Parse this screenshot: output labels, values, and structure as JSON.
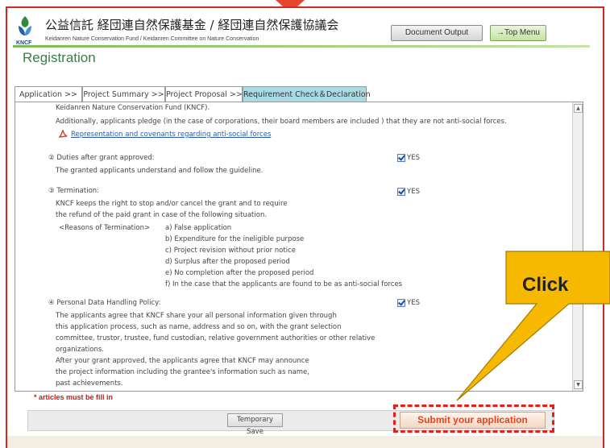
{
  "header": {
    "title_ja": "公益信託 経団連自然保護基金 / 経団連自然保護協議会",
    "title_en": "Keidanren Nature Conservation Fund / Keidanren Committee on Nature Conservation",
    "logo_text": "KNCF",
    "document_output_label": "Document Output",
    "top_menu_label": "→Top Menu"
  },
  "page": {
    "title": "Registration"
  },
  "tabs": [
    {
      "label": "Application >>"
    },
    {
      "label": "Project Summary >>"
    },
    {
      "label": "Project Proposal >>"
    },
    {
      "label": "Requirement Check＆Declaration",
      "active": true
    }
  ],
  "sections": {
    "s1": {
      "line1": "Keidanren Nature Conservation Fund (KNCF).",
      "line2": "Additionally, applicants pledge (in the case of corporations, their board members are included ) that they are not anti-social forces.",
      "link": "Representation and covenants regarding anti-social forces"
    },
    "s2": {
      "heading": "② Duties after grant approved:",
      "line1": "The granted applicants understand and follow the guideline.",
      "check": "YES"
    },
    "s3": {
      "heading": "③ Termination:",
      "line1": "KNCF keeps the right to stop and/or cancel the grant and to require",
      "line2": "the refund of the paid grant in case of the following situation.",
      "reasons_label": "<Reasons of Termination>",
      "reasons": [
        "a) False application",
        "b) Expenditure for the ineligible purpose",
        "c) Project revision without prior notice",
        "d) Surplus after the proposed period",
        "e) No completion after the proposed period",
        "f) In the case that the applicants are found to be as anti-social forces"
      ],
      "check": "YES"
    },
    "s4": {
      "heading": "④ Personal Data Handling Policy:",
      "lines": [
        "The applicants agree that KNCF share your all personal information given through",
        "this application process, such as name, address and so on, with the grant selection",
        "committee, trustor, trustee, fund custodian, relative government authorities or other relative",
        "organizations.",
        "After your grant approved,  the applicants agree that KNCF may announce",
        "the project information including the grantee's information such as name,",
        "past achievements."
      ],
      "check": "YES"
    }
  },
  "footer": {
    "required_note": "* articles must be fill in",
    "temp_save_label": "Temporary Save",
    "submit_label": "Submit your application"
  },
  "callout": {
    "text": "Click"
  },
  "colors": {
    "accent_red": "#e3201a",
    "tab_active": "#a9dbe5",
    "brand_green": "#3a7d4a",
    "callout_yellow": "#f7b800"
  }
}
